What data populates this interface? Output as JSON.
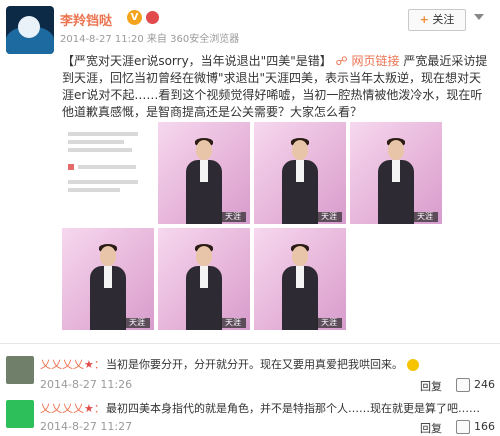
{
  "post": {
    "author_name": "李羚铛哒",
    "verified_badge": "V",
    "meta": "2014-8-27 11:20 来自 360安全浏览器",
    "follow_label": "关注",
    "text_prefix": "【严宽对天涯er说sorry，当年说退出\"四美\"是错】",
    "link_label": "网页链接",
    "text_body": "严宽最近采访提到天涯，回忆当初曾经在微博\"求退出\"天涯四美，表示当年太叛逆，现在想对天涯er说对不起……看到这个视频觉得好唏嘘，当初一腔热情被他泼冷水，现在听他道歉真感慨，是智商提高还是公关需要？大家怎么看？",
    "thumb_logo": "天涯"
  },
  "comments": [
    {
      "user_name": "乂乂乂乂",
      "text": "当初是你要分开，分开就分开。现在又要用真爱把我哄回来。",
      "time": "2014-8-27 11:26",
      "reply_label": "回复",
      "like_count": "246"
    },
    {
      "user_name": "乂乂乂乂",
      "text": "最初四美本身指代的就是角色，并不是特指那个人……现在就更是算了吧……",
      "time": "2014-8-27 11:27",
      "reply_label": "回复",
      "like_count": "166"
    }
  ],
  "icons": {
    "avatar": "blue-wave-avatar",
    "link": "link-icon",
    "like": "thumbs-up-icon",
    "follow": "plus-icon",
    "menu": "chevron-down-icon"
  },
  "colors": {
    "accent": "#eb7350",
    "badge": "#f3a31c",
    "pink_bg": "#e7b6da"
  }
}
